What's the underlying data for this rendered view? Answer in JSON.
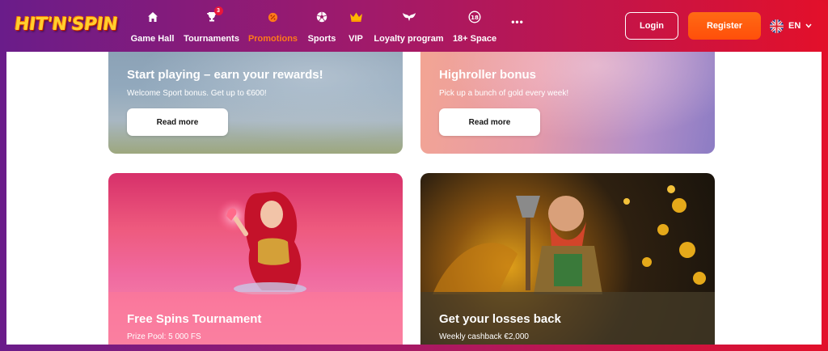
{
  "header": {
    "logo_text": "HIT'N'SPIN",
    "nav": [
      {
        "label": "Game Hall",
        "icon": "home-icon"
      },
      {
        "label": "Tournaments",
        "icon": "trophy-icon",
        "badge": "3"
      },
      {
        "label": "Promotions",
        "icon": "promotions-icon",
        "active": true
      },
      {
        "label": "Sports",
        "icon": "soccer-ball-icon"
      },
      {
        "label": "VIP",
        "icon": "crown-icon"
      },
      {
        "label": "Loyalty program",
        "icon": "wings-icon"
      },
      {
        "label": "18+ Space",
        "icon": "age-18-icon"
      },
      {
        "label": "•••",
        "icon": "more-icon"
      }
    ],
    "login_label": "Login",
    "register_label": "Register",
    "language": "EN"
  },
  "cards": [
    {
      "title": "Start playing – earn your rewards!",
      "subtitle": "Welcome Sport bonus. Get up to €600!",
      "button": "Read more"
    },
    {
      "title": "Highroller bonus",
      "subtitle": "Pick up a bunch of gold every week!",
      "button": "Read more"
    },
    {
      "title": "Free Spins Tournament",
      "subtitle": "Prize Pool: 5 000 FS"
    },
    {
      "title": "Get your losses back",
      "subtitle": "Weekly cashback €2,000"
    }
  ],
  "colors": {
    "accent_active": "#ff7a1a",
    "register_bg": "#ff5a10",
    "header_left": "#6a1c8a",
    "header_right": "#e3102a"
  }
}
